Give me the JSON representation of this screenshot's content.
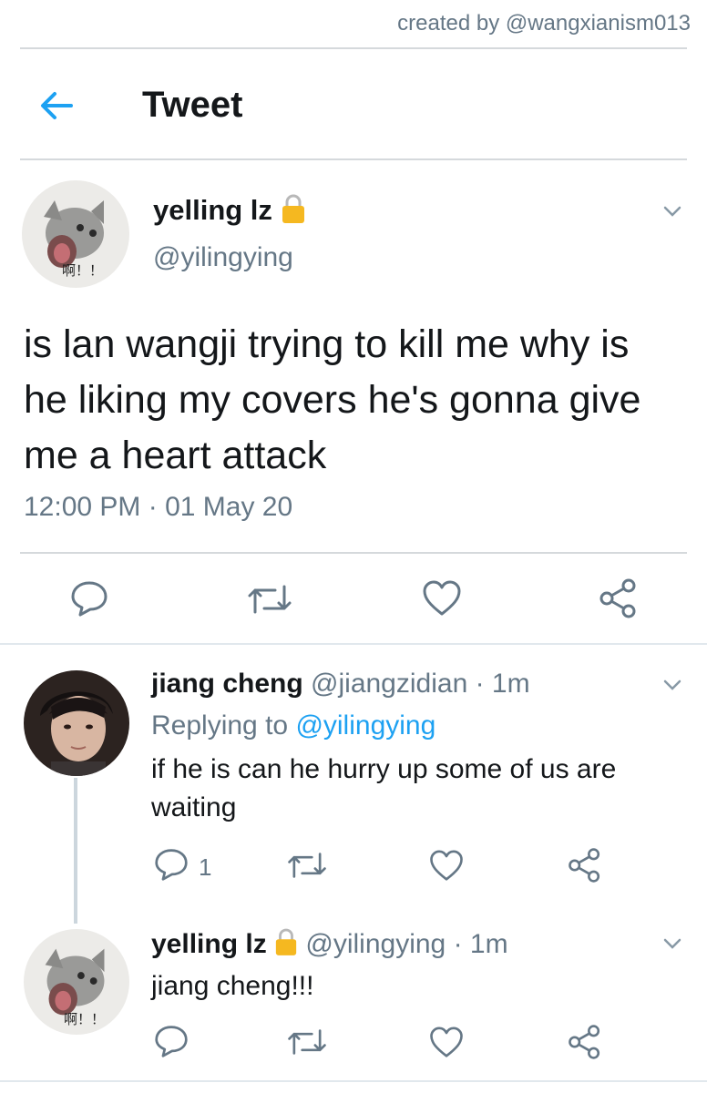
{
  "credit": "created by @wangxianism013",
  "header": {
    "title": "Tweet"
  },
  "main_tweet": {
    "name": "yelling lz",
    "handle": "@yilingying",
    "text": "is lan wangji trying to kill me why is he liking my covers he's gonna give me a heart attack",
    "timestamp": "12:00 PM · 01 May 20",
    "avatar_caption": "啊！！"
  },
  "replies": [
    {
      "name": "jiang cheng",
      "handle": "@jiangzidian",
      "time": "· 1m",
      "replying_label": "Replying to",
      "replying_to": "@yilingying",
      "text": "if he is can he hurry up some of us are waiting",
      "reply_count": "1"
    },
    {
      "name": "yelling lz",
      "handle": "@yilingying",
      "time": "· 1m",
      "text": "jiang cheng!!!",
      "avatar_caption": "啊！！"
    }
  ],
  "icons": {
    "back": "arrow-left-icon",
    "lock": "lock-icon",
    "chevron": "chevron-down-icon",
    "reply": "reply-icon",
    "retweet": "retweet-icon",
    "like": "heart-icon",
    "share": "share-icon"
  },
  "colors": {
    "accent": "#1da1f2",
    "secondary_text": "#657786",
    "lock": "#f5b820"
  }
}
